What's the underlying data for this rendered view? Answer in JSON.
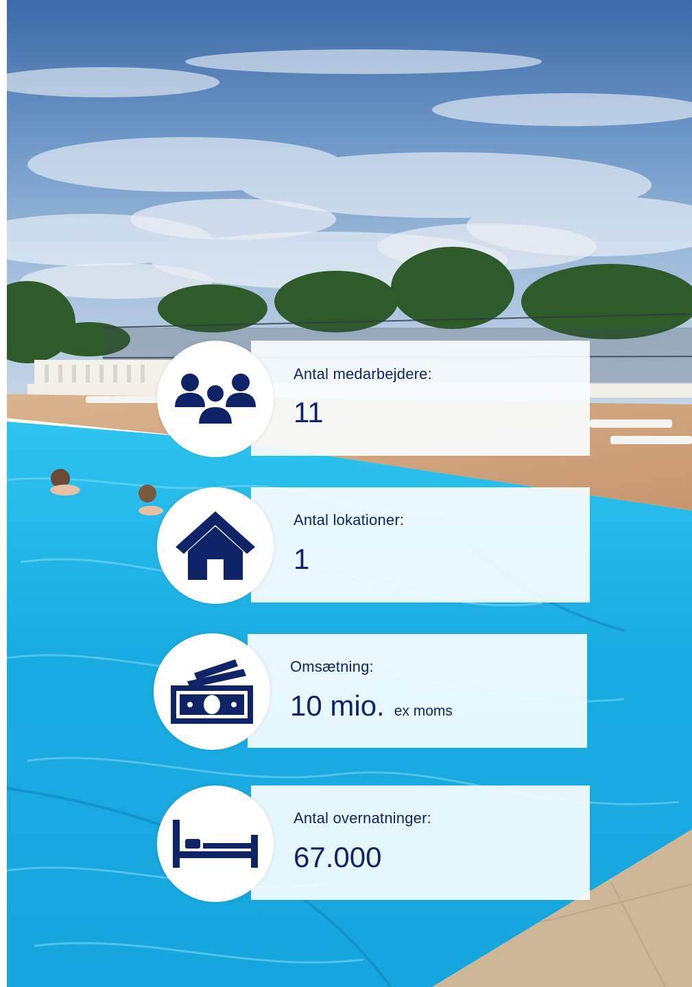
{
  "colors": {
    "navy": "#0f2466",
    "panel": "#f8fdff",
    "sky": "#6a97c7",
    "pool": "#29b3e6"
  },
  "stats": [
    {
      "icon": "people-group-icon",
      "label": "Antal medarbejdere:",
      "value": "11"
    },
    {
      "icon": "house-icon",
      "label": "Antal lokationer:",
      "value": "1"
    },
    {
      "icon": "money-stack-icon",
      "label": "Omsætning:",
      "value": "10 mio.",
      "suffix": "ex moms"
    },
    {
      "icon": "bed-icon",
      "label": "Antal overnatninger:",
      "value": "67.000"
    }
  ]
}
